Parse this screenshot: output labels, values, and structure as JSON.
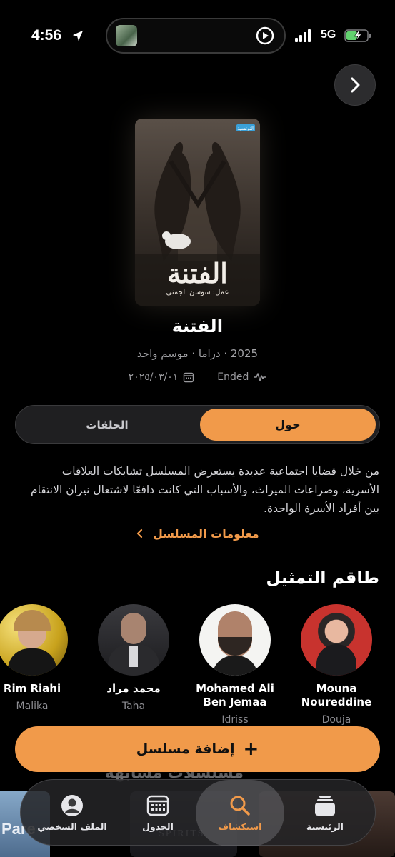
{
  "status_bar": {
    "time": "4:56",
    "network": "5G",
    "location_icon": "location-arrow-icon",
    "signal_icon": "cellular-signal-icon",
    "battery_icon": "battery-charging-icon",
    "play_icon": "play-circle-icon"
  },
  "show": {
    "poster_title": "الفتنة",
    "poster_subtitle": "عمل: سوسن الجمني",
    "poster_badge": "التونسية",
    "title": "الفتنة",
    "meta": "2025 · دراما · موسم واحد",
    "status": "Ended",
    "date": "٢٠٢٥/٠٣/٠١"
  },
  "tabs": {
    "about": "حول",
    "episodes": "الحلقات"
  },
  "description": "من خلال قضايا اجتماعية عديدة يستعرض المسلسل تشابكات العلاقات الأسرية، وصراعات الميراث، والأسباب التي كانت دافعًا لاشتعال نيران الانتقام بين أفراد الأسرة الواحدة.",
  "info_link": "معلومات المسلسل",
  "cast_title": "طاقم التمثيل",
  "cast": [
    {
      "name": "Mouna Noureddine",
      "role": "Douja"
    },
    {
      "name": "Mohamed Ali Ben Jemaa",
      "role": "Idriss"
    },
    {
      "name": "محمد مراد",
      "role": "Taha"
    },
    {
      "name": "Rim Riahi",
      "role": "Malika"
    }
  ],
  "add_button": "إضافة مسلسل",
  "tabbar": {
    "home": "الرئيسية",
    "explore": "استكشاف",
    "schedule": "الجدول",
    "profile": "الملف الشخصي"
  },
  "colors": {
    "accent": "#f19a4a",
    "background": "#000000",
    "muted": "#8e8e93"
  }
}
